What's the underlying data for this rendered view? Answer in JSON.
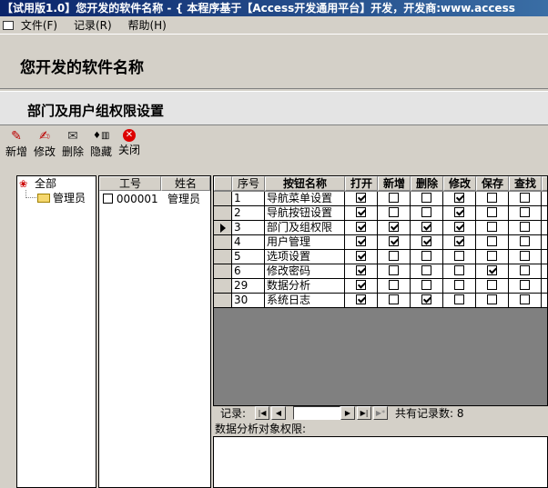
{
  "window": {
    "title": "【试用版1.0】您开发的软件名称 - { 本程序基于【Access开发通用平台】开发，开发商:www.access"
  },
  "menubar": {
    "items": [
      {
        "label": "文件(F)"
      },
      {
        "label": "记录(R)"
      },
      {
        "label": "帮助(H)"
      }
    ]
  },
  "header": {
    "app_title": "您开发的软件名称"
  },
  "page": {
    "title": "部门及用户组权限设置"
  },
  "toolbar": {
    "items": [
      {
        "label": "新增",
        "icon": "new-icon"
      },
      {
        "label": "修改",
        "icon": "edit-icon"
      },
      {
        "label": "删除",
        "icon": "delete-icon"
      },
      {
        "label": "隐藏",
        "icon": "hide-icon"
      },
      {
        "label": "关闭",
        "icon": "close-icon"
      }
    ]
  },
  "tree": {
    "root": "全部",
    "children": [
      "管理员"
    ]
  },
  "users": {
    "columns": [
      "工号",
      "姓名"
    ],
    "rows": [
      {
        "id": "000001",
        "name": "管理员",
        "checked": false
      }
    ]
  },
  "permissions": {
    "columns": [
      "序号",
      "按钮名称",
      "打开",
      "新增",
      "删除",
      "修改",
      "保存",
      "查找"
    ],
    "current_row": 2,
    "rows": [
      {
        "seq": "1",
        "name": "导航菜单设置",
        "flags": [
          true,
          false,
          false,
          true,
          false,
          false
        ]
      },
      {
        "seq": "2",
        "name": "导航按钮设置",
        "flags": [
          true,
          false,
          false,
          true,
          false,
          false
        ]
      },
      {
        "seq": "3",
        "name": "部门及组权限",
        "flags": [
          true,
          true,
          true,
          true,
          false,
          false
        ]
      },
      {
        "seq": "4",
        "name": "用户管理",
        "flags": [
          true,
          true,
          true,
          true,
          false,
          false
        ]
      },
      {
        "seq": "5",
        "name": "选项设置",
        "flags": [
          true,
          false,
          false,
          false,
          false,
          false
        ]
      },
      {
        "seq": "6",
        "name": "修改密码",
        "flags": [
          true,
          false,
          false,
          false,
          true,
          false
        ]
      },
      {
        "seq": "29",
        "name": "数据分析",
        "flags": [
          true,
          false,
          false,
          false,
          false,
          false
        ]
      },
      {
        "seq": "30",
        "name": "系统日志",
        "flags": [
          true,
          false,
          true,
          false,
          false,
          false
        ]
      }
    ]
  },
  "navigator": {
    "label": "记录:",
    "current": "",
    "total_label": "共有记录数: 8"
  },
  "subform": {
    "label": "数据分析对象权限:"
  },
  "colors": {
    "title_bar_start": "#0a246a",
    "title_bar_end": "#3a6ea5",
    "face": "#d4d0c8",
    "grid_empty": "#808080"
  }
}
